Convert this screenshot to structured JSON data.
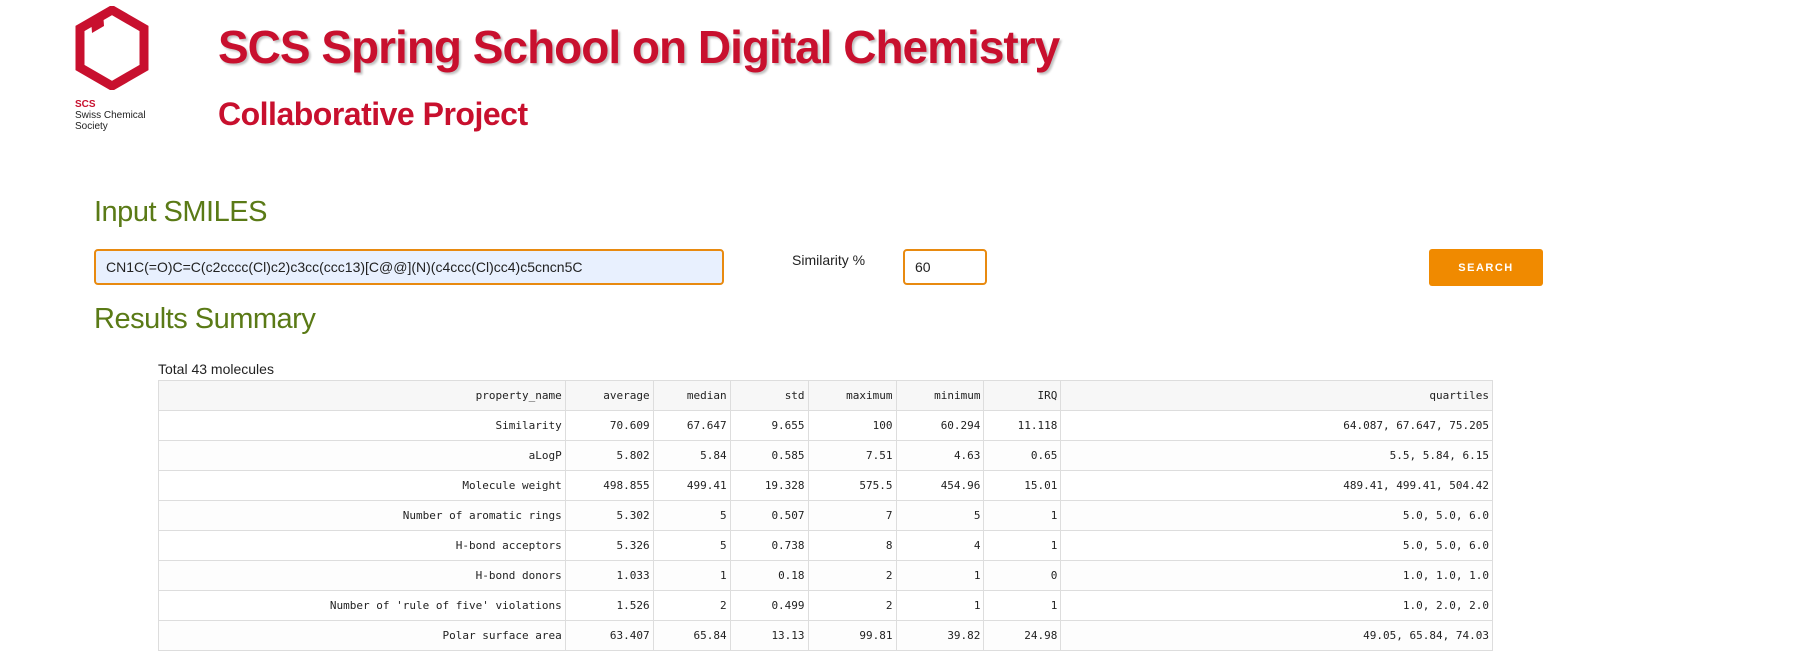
{
  "header": {
    "logo": {
      "abbr": "SCS",
      "line1": "Swiss Chemical",
      "line2": "Society"
    },
    "title": "SCS Spring School on Digital Chemistry",
    "subtitle": "Collaborative Project"
  },
  "colors": {
    "brand_red": "#c8102e",
    "heading_green": "#5a7a16",
    "accent_orange": "#f08a00"
  },
  "input": {
    "heading": "Input SMILES",
    "smiles_value": "CN1C(=O)C=C(c2cccc(Cl)c2)c3cc(ccc13)[C@@](N)(c4ccc(Cl)cc4)c5cncn5C",
    "similarity_label": "Similarity %",
    "similarity_value": "60",
    "search_label": "SEARCH"
  },
  "results": {
    "heading": "Results Summary",
    "total": "Total 43 molecules",
    "columns": [
      "property_name",
      "average",
      "median",
      "std",
      "maximum",
      "minimum",
      "IRQ",
      "quartiles"
    ],
    "rows": [
      [
        "Similarity",
        "70.609",
        "67.647",
        "9.655",
        "100",
        "60.294",
        "11.118",
        "64.087, 67.647, 75.205"
      ],
      [
        "aLogP",
        "5.802",
        "5.84",
        "0.585",
        "7.51",
        "4.63",
        "0.65",
        "5.5, 5.84, 6.15"
      ],
      [
        "Molecule weight",
        "498.855",
        "499.41",
        "19.328",
        "575.5",
        "454.96",
        "15.01",
        "489.41, 499.41, 504.42"
      ],
      [
        "Number of aromatic rings",
        "5.302",
        "5",
        "0.507",
        "7",
        "5",
        "1",
        "5.0, 5.0, 6.0"
      ],
      [
        "H-bond acceptors",
        "5.326",
        "5",
        "0.738",
        "8",
        "4",
        "1",
        "5.0, 5.0, 6.0"
      ],
      [
        "H-bond donors",
        "1.033",
        "1",
        "0.18",
        "2",
        "1",
        "0",
        "1.0, 1.0, 1.0"
      ],
      [
        "Number of 'rule of five' violations",
        "1.526",
        "2",
        "0.499",
        "2",
        "1",
        "1",
        "1.0, 2.0, 2.0"
      ],
      [
        "Polar surface area",
        "63.407",
        "65.84",
        "13.13",
        "99.81",
        "39.82",
        "24.98",
        "49.05, 65.84, 74.03"
      ]
    ]
  }
}
